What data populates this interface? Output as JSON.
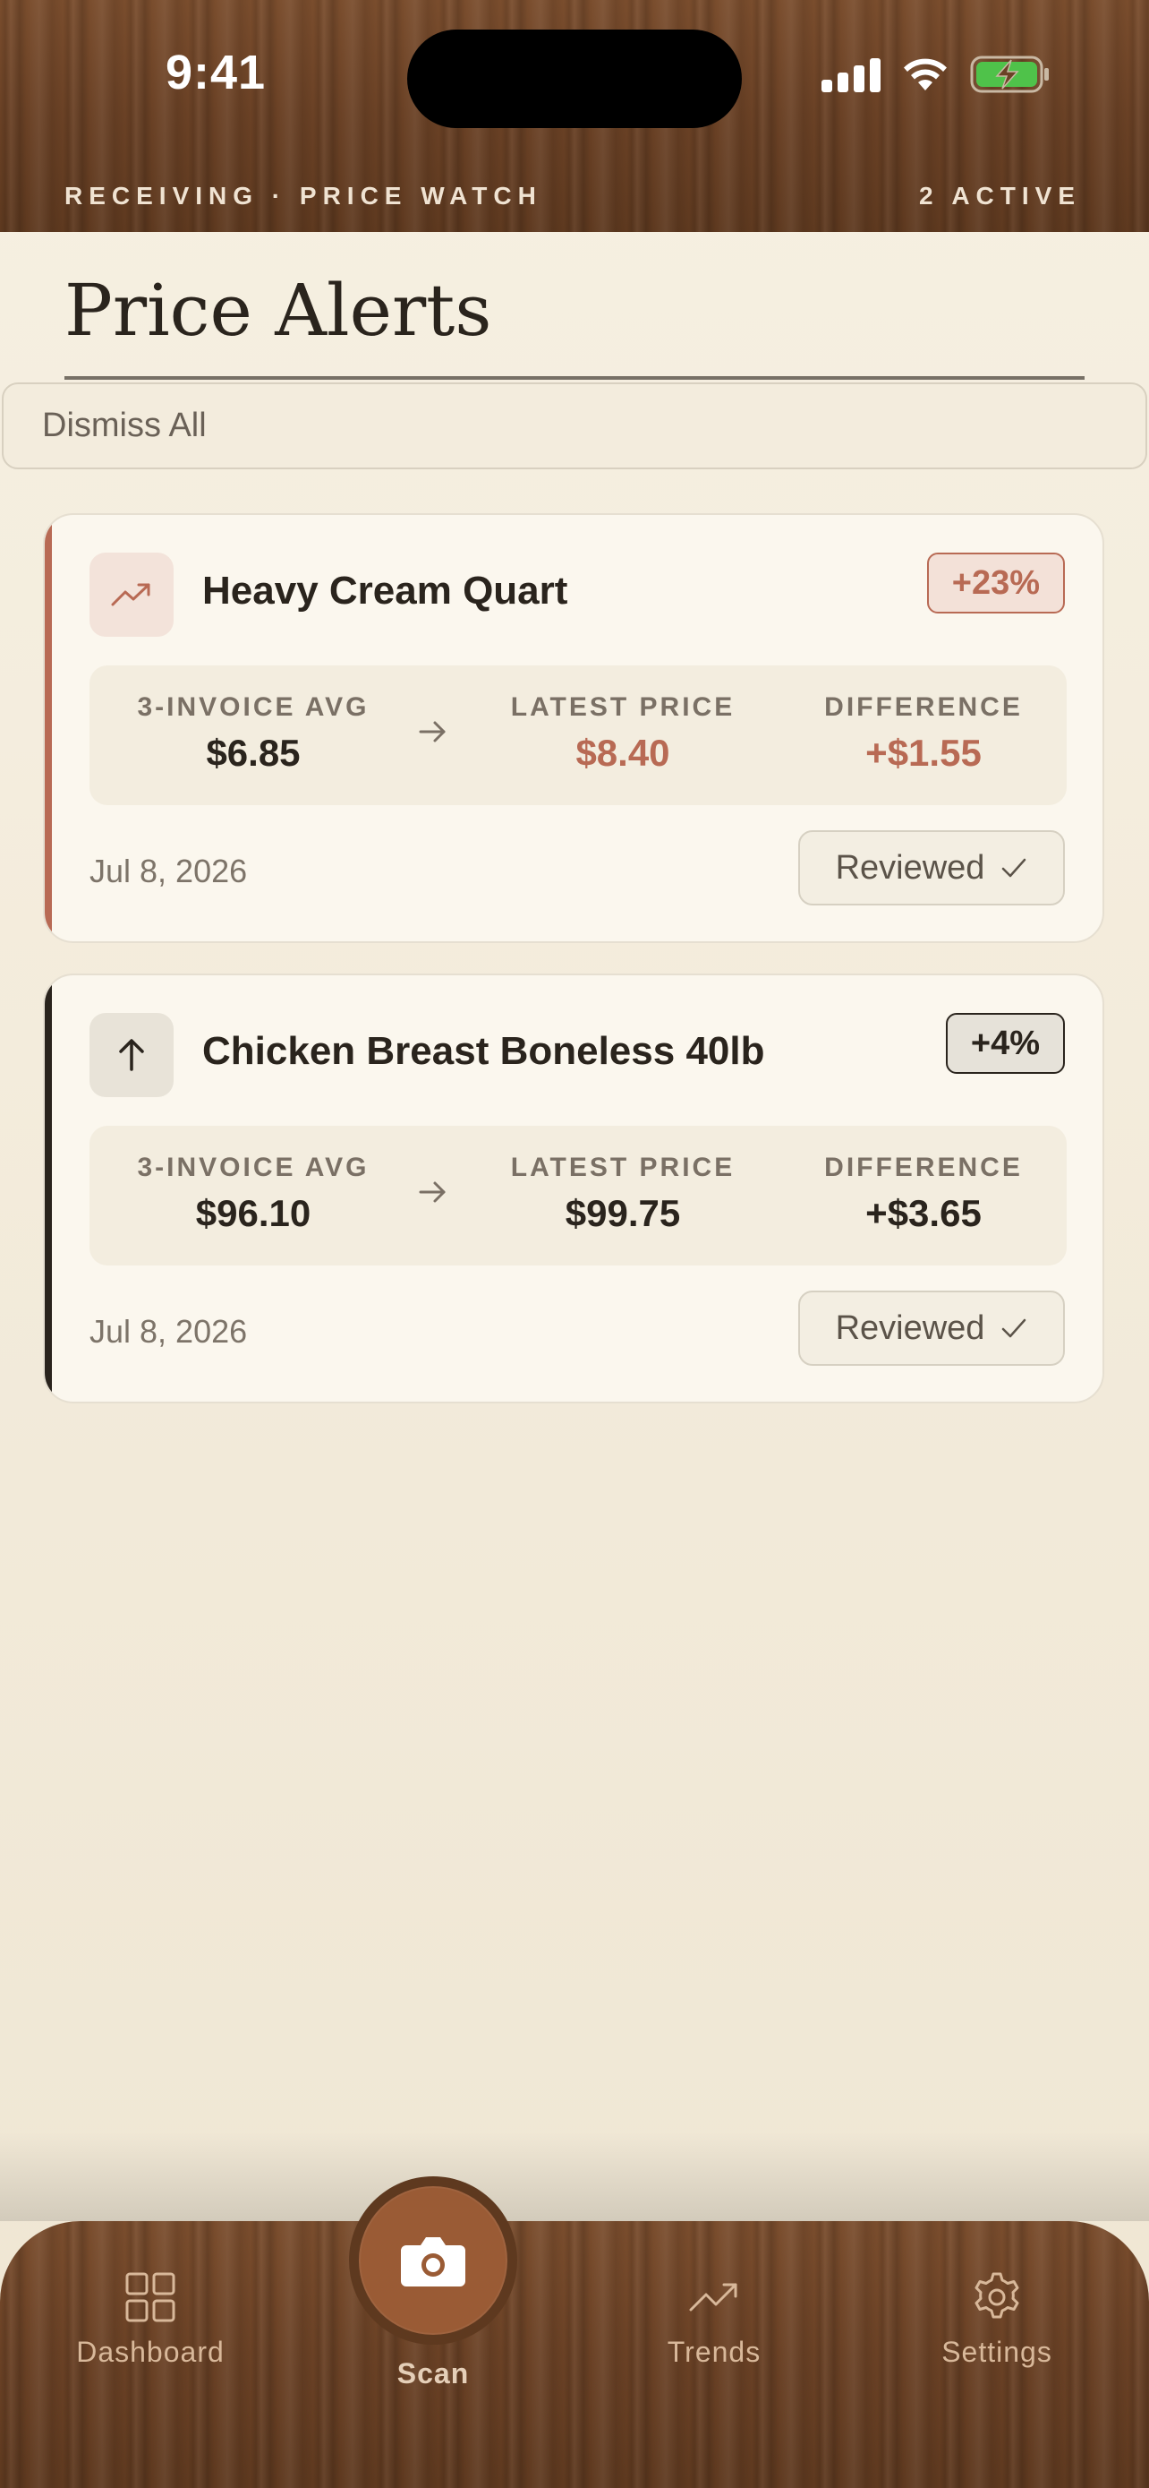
{
  "status_bar": {
    "time": "9:41"
  },
  "header": {
    "subtitle": "RECEIVING · PRICE WATCH",
    "count": "2 ACTIVE"
  },
  "page": {
    "title": "Price Alerts",
    "dismiss_label": "Dismiss All"
  },
  "colors": {
    "alert": "#b86a54",
    "neutral": "#2a241d",
    "wood": "#6b4226",
    "scan": "#9a5b35"
  },
  "alerts": [
    {
      "icon": "trending-up-icon",
      "name": "Heavy Cream Quart",
      "badge": "+23%",
      "avg_label": "3-INVOICE AVG",
      "avg_value": "$6.85",
      "latest_label": "LATEST PRICE",
      "latest_value": "$8.40",
      "diff_label": "DIFFERENCE",
      "diff_value": "+$1.55",
      "date": "Jul 8, 2026",
      "reviewed_label": "Reviewed"
    },
    {
      "icon": "arrow-up-icon",
      "name": "Chicken Breast Boneless 40lb",
      "badge": "+4%",
      "avg_label": "3-INVOICE AVG",
      "avg_value": "$96.10",
      "latest_label": "LATEST PRICE",
      "latest_value": "$99.75",
      "diff_label": "DIFFERENCE",
      "diff_value": "+$3.65",
      "date": "Jul 8, 2026",
      "reviewed_label": "Reviewed"
    }
  ],
  "nav": {
    "dashboard": "Dashboard",
    "scan": "Scan",
    "trends": "Trends",
    "settings": "Settings"
  }
}
